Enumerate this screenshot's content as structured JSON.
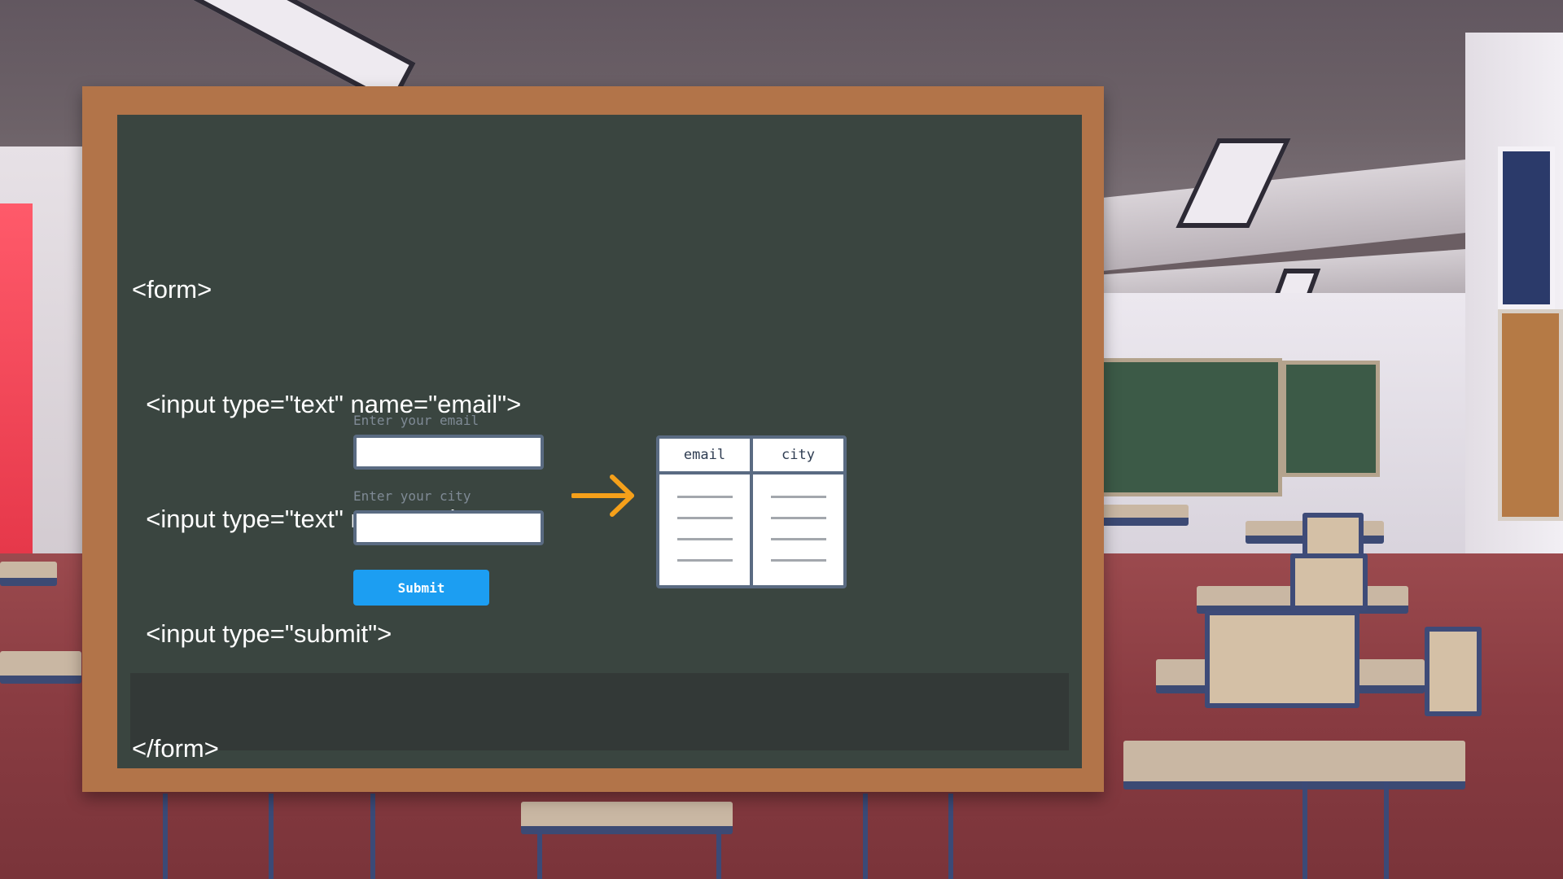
{
  "code_lines": [
    "<form>",
    "  <input type=\"text\" name=\"email\">",
    "  <input type=\"text\" name=\"city\">",
    "  <input type=\"submit\">",
    "</form>"
  ],
  "form_preview": {
    "email_label": "Enter your email",
    "city_label": "Enter your city",
    "submit_label": "Submit"
  },
  "table_preview": {
    "columns": [
      "email",
      "city"
    ]
  },
  "colors": {
    "board": "#3a4540",
    "frame": "#b27449",
    "submit": "#1c9ef2",
    "arrow": "#f5a01a"
  }
}
